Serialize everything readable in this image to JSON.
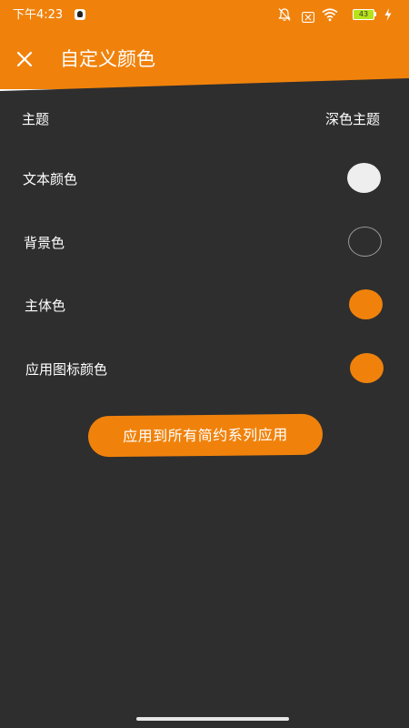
{
  "status_bar": {
    "time": "下午4:23",
    "battery_level": "43",
    "icons": [
      "qq-icon",
      "bell-off-icon",
      "sim-icon",
      "wifi-icon",
      "battery-icon",
      "charge-icon"
    ]
  },
  "app_bar": {
    "title": "自定义颜色",
    "close_icon": "close-icon"
  },
  "settings": {
    "theme": {
      "label": "主题",
      "value": "深色主题"
    },
    "text_color": {
      "label": "文本颜色",
      "color": "#EEEEEE"
    },
    "background_color": {
      "label": "背景色",
      "color": "#2E2E2E"
    },
    "primary_color": {
      "label": "主体色",
      "color": "#F0820C"
    },
    "app_icon_color": {
      "label": "应用图标颜色",
      "color": "#F0820C"
    }
  },
  "apply_button": {
    "label": "应用到所有简约系列应用"
  },
  "colors": {
    "accent": "#F0820C",
    "background": "#2E2E2E",
    "text": "#FFFFFF"
  }
}
